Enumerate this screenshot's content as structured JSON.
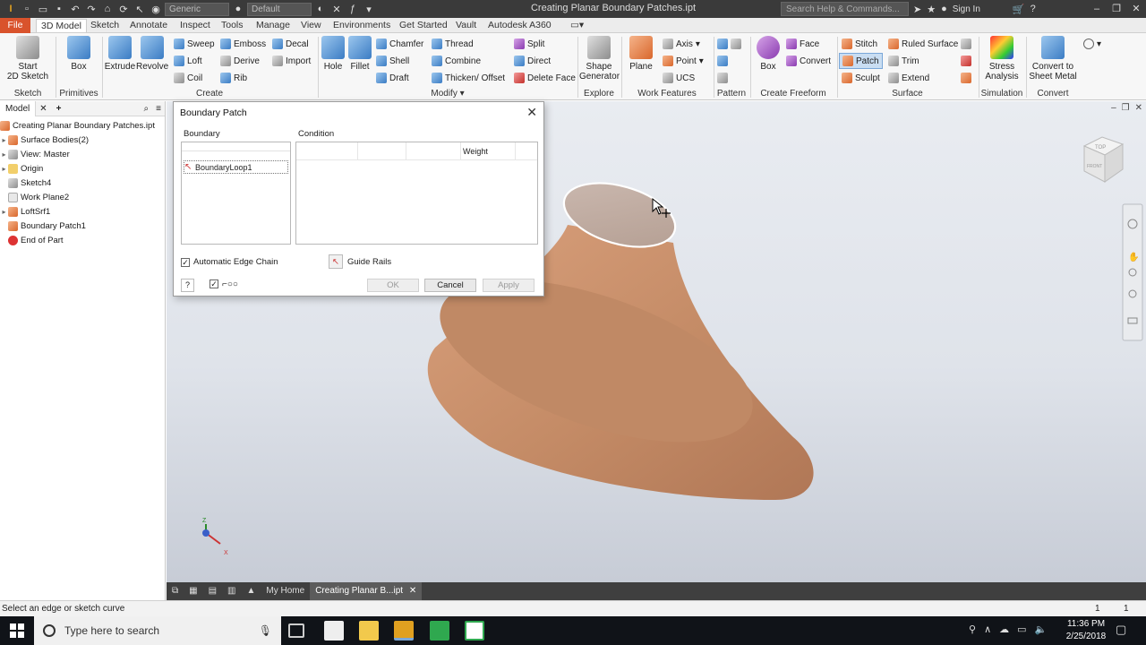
{
  "titlebar": {
    "title": "Creating Planar Boundary Patches.ipt",
    "material": "Generic",
    "appearance": "Default",
    "search_placeholder": "Search Help & Commands...",
    "sign_in": "Sign In"
  },
  "tabs": [
    "File",
    "3D Model",
    "Sketch",
    "Annotate",
    "Inspect",
    "Tools",
    "Manage",
    "View",
    "Environments",
    "Get Started",
    "Vault",
    "Autodesk A360"
  ],
  "ribbon": {
    "start_sketch": "Start\n2D Sketch",
    "box": "Box",
    "extrude": "Extrude",
    "revolve": "Revolve",
    "sweep": "Sweep",
    "emboss": "Emboss",
    "decal": "Decal",
    "loft": "Loft",
    "derive": "Derive",
    "import": "Import",
    "coil": "Coil",
    "rib": "Rib",
    "hole": "Hole",
    "fillet": "Fillet",
    "chamfer": "Chamfer",
    "thread": "Thread",
    "split": "Split",
    "shell": "Shell",
    "combine": "Combine",
    "direct": "Direct",
    "draft": "Draft",
    "thicken": "Thicken/ Offset",
    "delete_face": "Delete Face",
    "shape_generator": "Shape\nGenerator",
    "plane": "Plane",
    "axis": "Axis",
    "point": "Point",
    "ucs": "UCS",
    "ff_box": "Box",
    "face": "Face",
    "convert": "Convert",
    "stitch": "Stitch",
    "ruled_surface": "Ruled Surface",
    "patch": "Patch",
    "trim": "Trim",
    "sculpt": "Sculpt",
    "extend": "Extend",
    "stress": "Stress\nAnalysis",
    "convert_sheet": "Convert to\nSheet Metal",
    "groups": {
      "sketch": "Sketch",
      "primitives": "Primitives",
      "create": "Create",
      "modify": "Modify",
      "explore": "Explore",
      "work_features": "Work Features",
      "pattern": "Pattern",
      "create_freeform": "Create Freeform",
      "surface": "Surface",
      "simulation": "Simulation",
      "convert": "Convert"
    }
  },
  "browser": {
    "tab": "Model",
    "items": [
      {
        "label": "Creating Planar Boundary Patches.ipt"
      },
      {
        "label": "Surface Bodies(2)"
      },
      {
        "label": "View: Master"
      },
      {
        "label": "Origin"
      },
      {
        "label": "Sketch4"
      },
      {
        "label": "Work Plane2"
      },
      {
        "label": "LoftSrf1"
      },
      {
        "label": "Boundary Patch1"
      },
      {
        "label": "End of Part"
      }
    ]
  },
  "dialog": {
    "title": "Boundary Patch",
    "boundary_label": "Boundary",
    "condition_label": "Condition",
    "weight_label": "Weight",
    "boundary_item": "BoundaryLoop1",
    "auto_edge_chain": "Automatic Edge Chain",
    "guide_rails": "Guide Rails",
    "ok": "OK",
    "cancel": "Cancel",
    "apply": "Apply"
  },
  "viewcube": {
    "top": "TOP",
    "front": "FRONT"
  },
  "doctabs": {
    "home": "My Home",
    "active": "Creating Planar B...ipt"
  },
  "status": {
    "message": "Select an edge or sketch curve",
    "count1": "1",
    "count2": "1"
  },
  "taskbar": {
    "search": "Type here to search",
    "time": "11:36 PM",
    "date": "2/25/2018"
  },
  "colors": {
    "file_tab": "#d9532c",
    "model_surface": "#c8926c",
    "viewport_bg": "#e4e7ec"
  }
}
